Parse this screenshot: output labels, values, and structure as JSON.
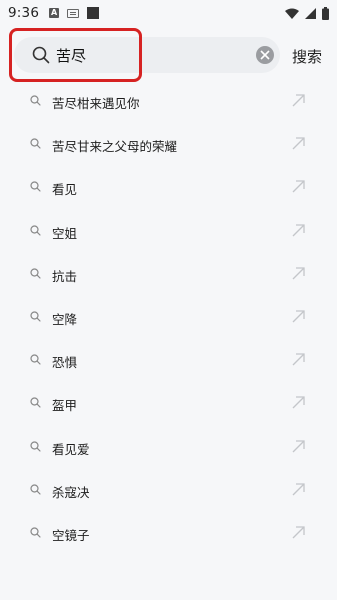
{
  "status_bar": {
    "time": "9:36",
    "a_icon_letter": "A"
  },
  "search": {
    "query": "苦尽",
    "submit_label": "搜索"
  },
  "suggestions": [
    "苦尽柑来遇见你",
    "苦尽甘来之父母的荣耀",
    "看见",
    "空姐",
    "抗击",
    "空降",
    "恐惧",
    "盔甲",
    "看见爱",
    "杀寇决",
    "空镜子"
  ],
  "colors": {
    "highlight": "#d62222",
    "background": "#f6f7f9",
    "search_bg": "#eceef1"
  }
}
